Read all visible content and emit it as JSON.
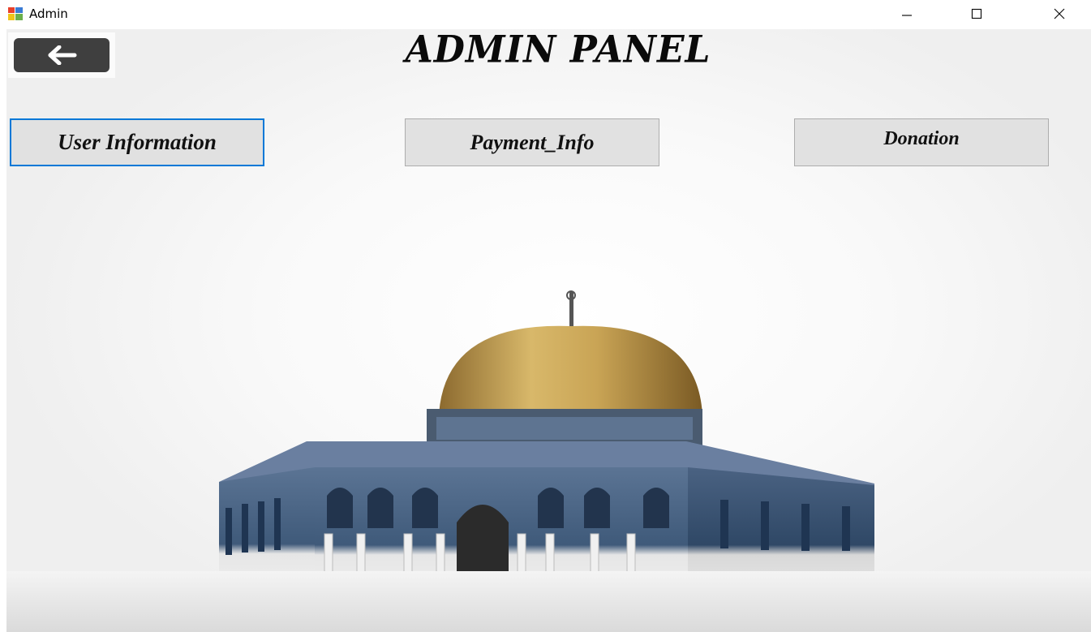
{
  "window": {
    "title": "Admin",
    "minimize_icon": "minimize-icon",
    "maximize_icon": "maximize-icon",
    "close_icon": "close-icon"
  },
  "header": {
    "title": "ADMIN PANEL",
    "back_icon": "arrow-left-icon"
  },
  "nav": {
    "user_info_label": "User Information",
    "payment_info_label": "Payment_Info",
    "donation_label": "Donation"
  },
  "background": {
    "subject": "dome-mosque-image"
  },
  "colors": {
    "focus_border": "#0078d7",
    "button_face": "#e1e1e1",
    "dome_gold": "#c9a455",
    "wall_blue": "#3f5a7a"
  }
}
